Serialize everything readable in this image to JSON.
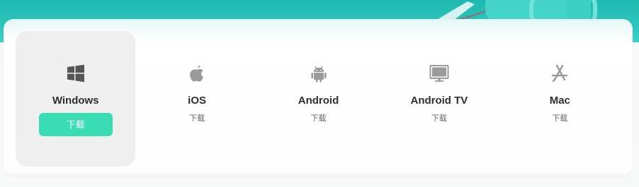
{
  "colors": {
    "hero": "#2cc6bc",
    "accent_button": "#39dcb3",
    "active_tile": "#efefef",
    "icon_gray": "#9a9a9a",
    "icon_dark": "#555555"
  },
  "platforms": [
    {
      "name": "Windows",
      "icon": "windows-icon",
      "action": "下载",
      "active": true
    },
    {
      "name": "iOS",
      "icon": "apple-icon",
      "action": "下载",
      "active": false
    },
    {
      "name": "Android",
      "icon": "android-icon",
      "action": "下载",
      "active": false
    },
    {
      "name": "Android TV",
      "icon": "tv-icon",
      "action": "下载",
      "active": false
    },
    {
      "name": "Mac",
      "icon": "app-store-icon",
      "action": "下载",
      "active": false
    }
  ]
}
